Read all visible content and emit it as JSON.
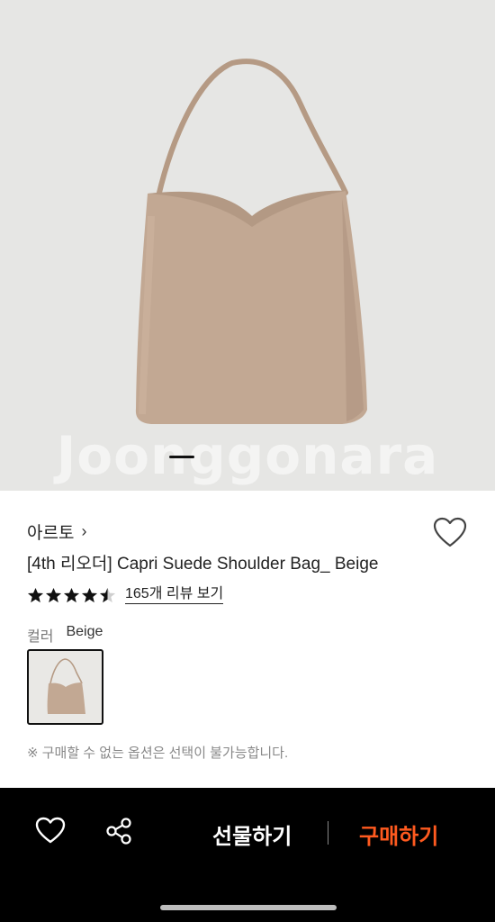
{
  "product_image": {
    "watermark": "Joonggonara",
    "alt": "beige suede shoulder bag"
  },
  "product": {
    "brand": "아르토",
    "brand_chevron": "›",
    "title": "[4th 리오더] Capri Suede Shoulder Bag_ Beige",
    "rating": 4.5,
    "review_link": "165개 리뷰 보기",
    "option_label": "컬러",
    "option_value": "Beige",
    "notice": "※ 구매할 수 없는 옵션은 선택이 불가능합니다."
  },
  "bottom_bar": {
    "gift_label": "선물하기",
    "buy_label": "구매하기"
  },
  "colors": {
    "buy": "#ff5a1f",
    "bag": "#c2a893",
    "background": "#e6e6e4"
  }
}
